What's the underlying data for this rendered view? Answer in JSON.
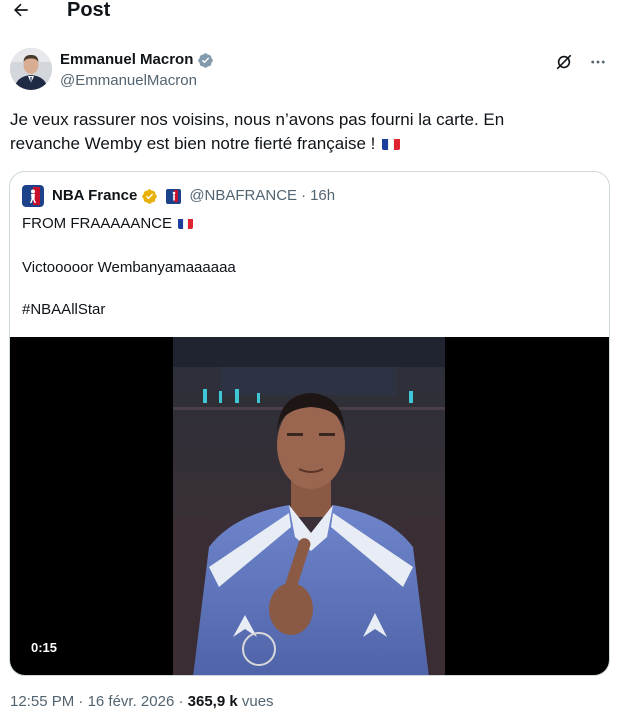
{
  "header": {
    "title": "Post",
    "back_icon": "arrow-left-icon"
  },
  "author": {
    "display_name": "Emmanuel Macron",
    "handle": "@EmmanuelMacron",
    "verified_color": "#829aab"
  },
  "post": {
    "text_line1": "Je veux rassurer nos voisins, nous n’avons pas fourni la carte. En",
    "text_line2": "revanche Wemby est bien notre fierté française !"
  },
  "quote": {
    "display_name": "NBA France",
    "handle": "@NBAFRANCE",
    "separator": "·",
    "time": "16h",
    "verified_color": "#e8b10a",
    "line1": "FROM FRAAAAANCE",
    "line2": "Victooooor Wembanyamaaaaaa",
    "line3": "#NBAAllStar",
    "video_duration": "0:15"
  },
  "meta": {
    "time": "12:55 PM",
    "separator": "·",
    "date": "16 févr. 2026",
    "views_count": "365,9 k",
    "views_label": "vues"
  },
  "colors": {
    "text": "#0f1419",
    "secondary": "#536471",
    "border": "#cfd9de",
    "flag_blue": "#1a3f9c",
    "flag_red": "#e0242f"
  }
}
